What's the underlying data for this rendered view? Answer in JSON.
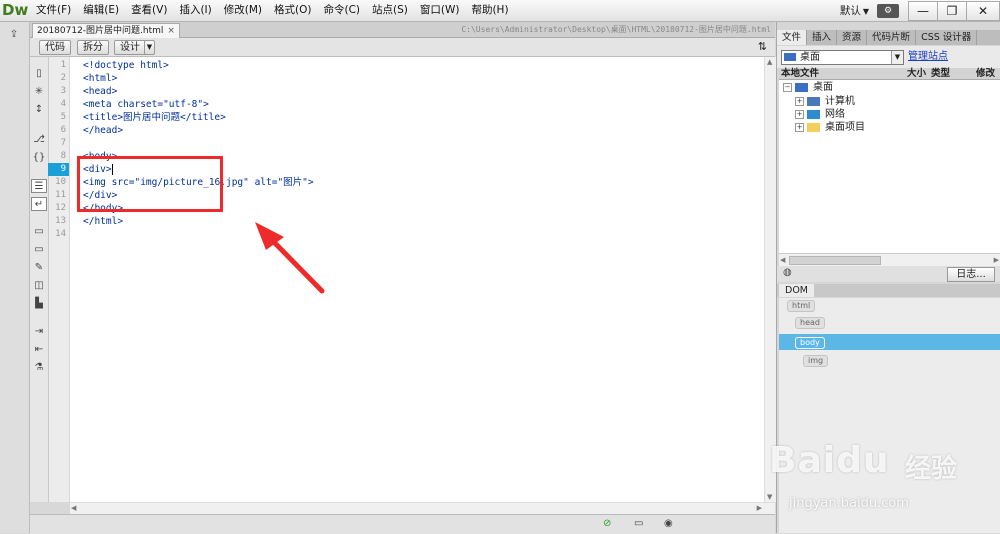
{
  "app": {
    "logo": "Dw"
  },
  "menu": [
    "文件(F)",
    "编辑(E)",
    "查看(V)",
    "插入(I)",
    "修改(M)",
    "格式(O)",
    "命令(C)",
    "站点(S)",
    "窗口(W)",
    "帮助(H)"
  ],
  "workspace": {
    "label": "默认",
    "caret": "▼"
  },
  "window_controls": {
    "minimize": "—",
    "restore": "❐",
    "close": "✕"
  },
  "document": {
    "tab_title": "20180712-图片居中问题.html",
    "tab_close": "×",
    "path": "C:\\Users\\Administrator\\Desktop\\桌面\\HTML\\20180712-图片居中问题.html"
  },
  "view_buttons": {
    "code": "代码",
    "split": "拆分",
    "design": "设计"
  },
  "line_numbers": [
    "1",
    "2",
    "3",
    "4",
    "5",
    "6",
    "7",
    "8",
    "9",
    "10",
    "11",
    "12",
    "13",
    "14"
  ],
  "current_line": "9",
  "code_lines": [
    "<!doctype html>",
    "<html>",
    "<head>",
    "<meta charset=\"utf-8\">",
    "<title>图片居中问题</title>",
    "</head>",
    "",
    "<body>",
    "<div>",
    "<img src=\"img/picture_16.jpg\" alt=\"图片\">",
    "</div>",
    "</body>",
    "</html>",
    ""
  ],
  "files_panel": {
    "tabs": [
      "文件",
      "插入",
      "资源",
      "代码片断",
      "CSS 设计器"
    ],
    "site": "桌面",
    "manage_link": "管理站点",
    "columns": [
      "本地文件",
      "大小",
      "类型",
      "修改"
    ],
    "tree": [
      {
        "label": "桌面",
        "level": 0
      },
      {
        "label": "计算机",
        "level": 1
      },
      {
        "label": "网络",
        "level": 1
      },
      {
        "label": "桌面项目",
        "level": 1
      }
    ],
    "log_button": "日志..."
  },
  "dom_panel": {
    "tab": "DOM",
    "nodes": [
      "html",
      "head",
      "body",
      "img"
    ],
    "selected": "body"
  },
  "watermark": {
    "brand": "Baidu",
    "cn": "经验",
    "url": "jingyan.baidu.com"
  },
  "colors": {
    "accent": "#1a9fd8",
    "highlight_box": "#ee2a2a",
    "dom_selected": "#5cb6e6"
  }
}
